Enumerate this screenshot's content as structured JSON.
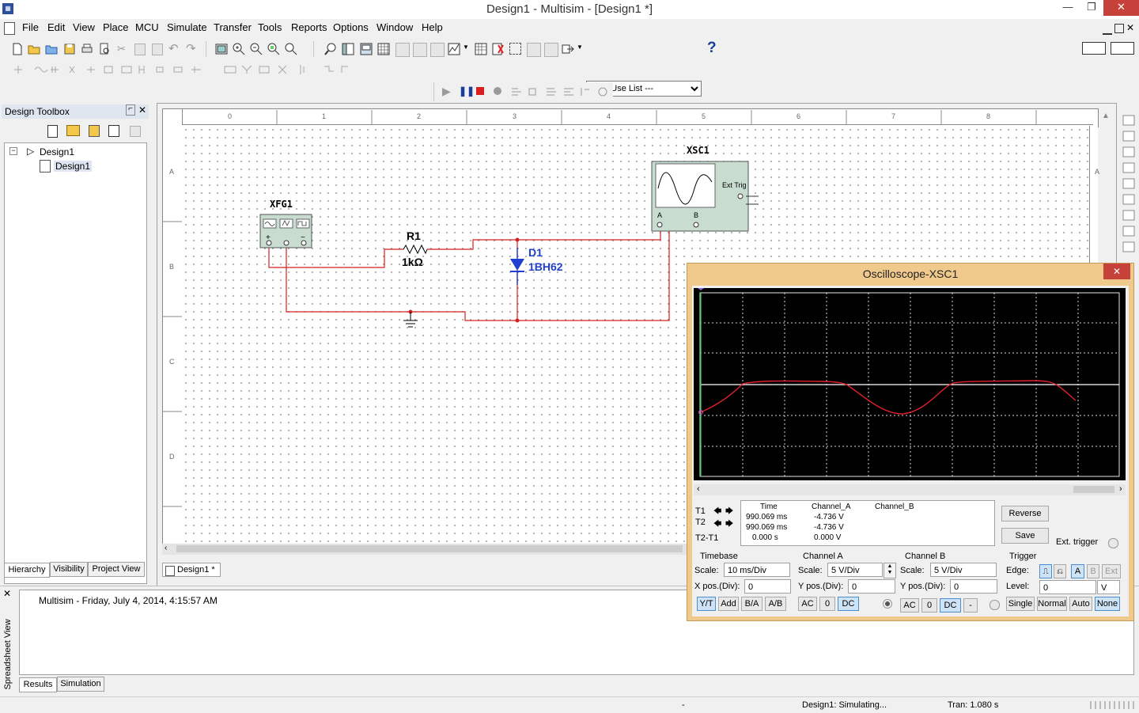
{
  "window": {
    "title": "Design1 - Multisim - [Design1 *]"
  },
  "menu": [
    {
      "u": "F",
      "rest": "ile"
    },
    {
      "u": "E",
      "rest": "dit"
    },
    {
      "u": "V",
      "rest": "iew"
    },
    {
      "u": "P",
      "rest": "lace"
    },
    {
      "u": "M",
      "rest": "CU"
    },
    {
      "u": "S",
      "rest": "imulate"
    },
    {
      "u": "T",
      "rest": "ransfer",
      "pre": "Tra",
      "post": "sfer"
    },
    {
      "u": "T",
      "rest": "ools"
    },
    {
      "u": "R",
      "rest": "eports"
    },
    {
      "u": "O",
      "rest": "ptions"
    },
    {
      "u": "W",
      "rest": "indow"
    },
    {
      "u": "H",
      "rest": "elp"
    }
  ],
  "menu_labels": [
    "File",
    "Edit",
    "View",
    "Place",
    "MCU",
    "Simulate",
    "Transfer",
    "Tools",
    "Reports",
    "Options",
    "Window",
    "Help"
  ],
  "toolbar": {
    "in_use_list": "--- In Use List ---",
    "help_glyph": "?"
  },
  "design_toolbox": {
    "title": "Design Toolbox",
    "tree_root": "Design1",
    "tree_child": "Design1",
    "tabs": [
      "Hierarchy",
      "Visibility",
      "Project View"
    ]
  },
  "canvas": {
    "ruler_cols": [
      "0",
      "1",
      "2",
      "3",
      "4",
      "5",
      "6",
      "7",
      "8"
    ],
    "ruler_rows": [
      "A",
      "B",
      "C",
      "D"
    ],
    "tab": "Design1 *"
  },
  "circuit": {
    "xfg_label": "XFG1",
    "r_ref": "R1",
    "r_value": "1kΩ",
    "d_ref": "D1",
    "d_value": "1BH62",
    "xsc_label": "XSC1",
    "ext_trig": "Ext Trig",
    "ch_a": "A",
    "ch_b": "B"
  },
  "colors": {
    "wire": "#d42020",
    "diode": "#1f3fd0",
    "trace": "#e0202a",
    "osc_frame": "#f0c98c"
  },
  "spreadsheet": {
    "side_title": "Spreadsheet View",
    "message": "Multisim  -  Friday, July 4, 2014, 4:15:57 AM",
    "tabs": [
      "Results",
      "Simulation"
    ]
  },
  "status": {
    "dash": "-",
    "state": "Design1: Simulating...",
    "tran": "Tran: 1.080 s"
  },
  "oscilloscope": {
    "title": "Oscilloscope-XSC1",
    "close": "✕",
    "readout": {
      "headers": [
        "Time",
        "Channel_A",
        "Channel_B"
      ],
      "row_labels": [
        "T1",
        "T2",
        "T2-T1"
      ],
      "time": [
        "990.069 ms",
        "990.069 ms",
        "0.000 s"
      ],
      "channel_a": [
        "-4.736 V",
        "-4.736 V",
        "0.000 V"
      ]
    },
    "reverse": "Reverse",
    "save": "Save",
    "ext_trigger": "Ext. trigger",
    "timebase": {
      "title": "Timebase",
      "scale_label": "Scale:",
      "scale": "10 ms/Div",
      "xpos_label": "X pos.(Div):",
      "xpos": "0",
      "modes": [
        "Y/T",
        "Add",
        "B/A",
        "A/B"
      ]
    },
    "channel_a": {
      "title": "Channel A",
      "scale_label": "Scale:",
      "scale": "5  V/Div",
      "ypos_label": "Y pos.(Div):",
      "ypos": "0",
      "coupling": [
        "AC",
        "0",
        "DC"
      ]
    },
    "channel_b": {
      "title": "Channel B",
      "scale_label": "Scale:",
      "scale": "5  V/Div",
      "ypos_label": "Y pos.(Div):",
      "ypos": "0",
      "coupling": [
        "AC",
        "0",
        "DC",
        "-"
      ]
    },
    "trigger": {
      "title": "Trigger",
      "edge_label": "Edge:",
      "sources": [
        "A",
        "B",
        "Ext"
      ],
      "level_label": "Level:",
      "level": "0",
      "level_unit": "V",
      "modes": [
        "Single",
        "Normal",
        "Auto",
        "None"
      ]
    }
  }
}
